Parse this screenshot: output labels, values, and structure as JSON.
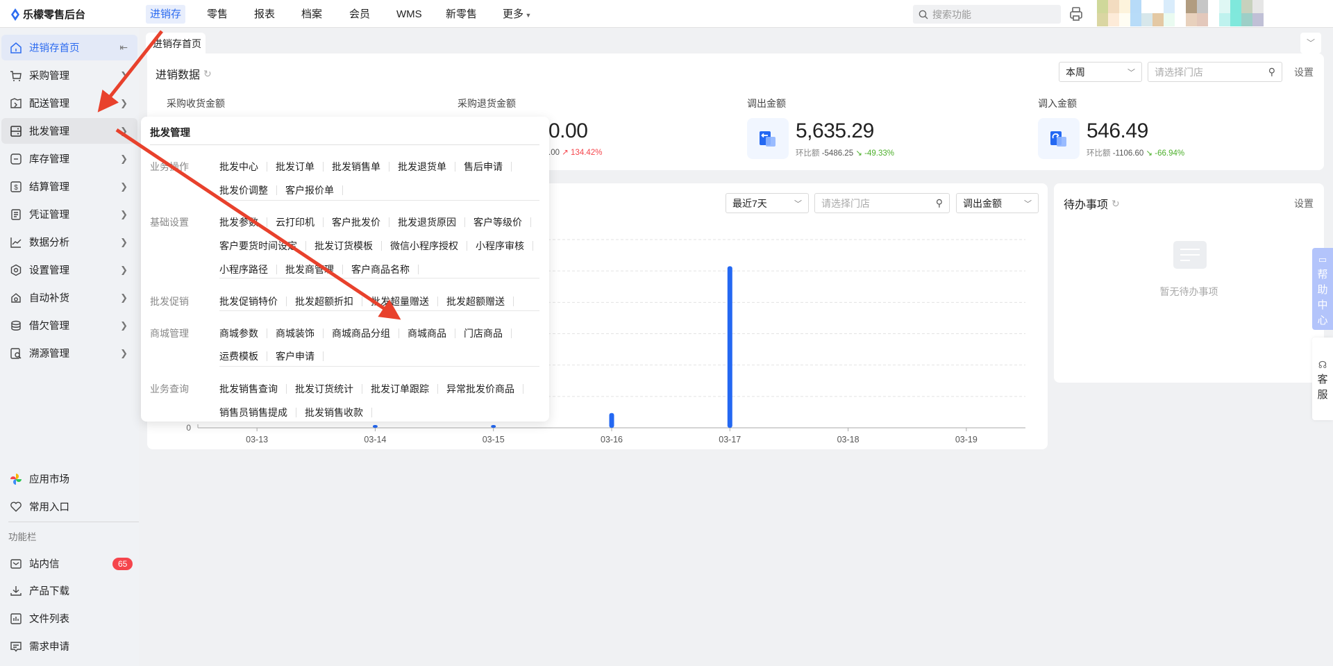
{
  "app": {
    "title": "乐檬零售后台"
  },
  "topnav": {
    "items": [
      "进销存",
      "零售",
      "报表",
      "档案",
      "会员",
      "WMS",
      "新零售",
      "更多"
    ],
    "active_index": 0,
    "search_placeholder": "搜索功能"
  },
  "sidebar": {
    "items": [
      {
        "label": "进销存首页",
        "icon": "home-icon"
      },
      {
        "label": "采购管理",
        "icon": "cart-icon"
      },
      {
        "label": "配送管理",
        "icon": "delivery-icon"
      },
      {
        "label": "批发管理",
        "icon": "wholesale-icon"
      },
      {
        "label": "库存管理",
        "icon": "inventory-icon"
      },
      {
        "label": "结算管理",
        "icon": "settlement-icon"
      },
      {
        "label": "凭证管理",
        "icon": "voucher-icon"
      },
      {
        "label": "数据分析",
        "icon": "chart-icon"
      },
      {
        "label": "设置管理",
        "icon": "settings-icon"
      },
      {
        "label": "自动补货",
        "icon": "replenish-icon"
      },
      {
        "label": "借欠管理",
        "icon": "debt-icon"
      },
      {
        "label": "溯源管理",
        "icon": "trace-icon"
      }
    ],
    "bottom": {
      "app_market": "应用市场",
      "favorites": "常用入口",
      "section_label": "功能栏",
      "messages": "站内信",
      "messages_count": "65",
      "downloads": "产品下载",
      "file_list": "文件列表",
      "requests": "需求申请"
    }
  },
  "tabs": {
    "items": [
      "进销存首页"
    ]
  },
  "summary": {
    "title": "进销数据",
    "period": "本周",
    "store_placeholder": "请选择门店",
    "settings": "设置",
    "metrics": [
      {
        "label": "采购收货金额"
      },
      {
        "label": "采购退货金额",
        "value": "0.00",
        "compare_value": ".00",
        "trend": "134.42%",
        "direction": "up"
      },
      {
        "label": "调出金额",
        "value": "5,635.29",
        "compare_label": "环比额",
        "compare_value": "-5486.25",
        "trend": "-49.33%",
        "direction": "down"
      },
      {
        "label": "调入金额",
        "value": "546.49",
        "compare_label": "环比额",
        "compare_value": "-1106.60",
        "trend": "-66.94%",
        "direction": "down"
      }
    ]
  },
  "trend_panel": {
    "range": "最近7天",
    "store_placeholder": "请选择门店",
    "metric": "调出金额"
  },
  "chart_data": {
    "type": "bar",
    "categories": [
      "03-13",
      "03-14",
      "03-15",
      "03-16",
      "03-17",
      "03-18",
      "03-19"
    ],
    "values": [
      0,
      8,
      8,
      470,
      5150,
      0,
      0
    ],
    "ylim": [
      0,
      6000
    ],
    "yticks": [
      0,
      1000,
      2000,
      3000,
      4000,
      5000,
      6000
    ],
    "visible_ytick_labels": [
      "0"
    ],
    "grid": true,
    "color": "#2468f2"
  },
  "todo": {
    "title": "待办事项",
    "settings": "设置",
    "empty_text": "暂无待办事项"
  },
  "float": {
    "help": "帮助中心",
    "service": "客服"
  },
  "popup": {
    "title": "批发管理",
    "sections": [
      {
        "label": "业务操作",
        "rows": [
          [
            "批发中心",
            "批发订单",
            "批发销售单",
            "批发退货单",
            "售后申请"
          ],
          [
            "批发价调整",
            "客户报价单"
          ]
        ]
      },
      {
        "label": "基础设置",
        "rows": [
          [
            "批发参数",
            "云打印机",
            "客户批发价",
            "批发退货原因",
            "客户等级价"
          ],
          [
            "客户要货时间设定",
            "批发订货模板",
            "微信小程序授权",
            "小程序审核"
          ],
          [
            "小程序路径",
            "批发商管理",
            "客户商品名称"
          ]
        ]
      },
      {
        "label": "批发促销",
        "rows": [
          [
            "批发促销特价",
            "批发超额折扣",
            "批发超量赠送",
            "批发超额赠送"
          ]
        ]
      },
      {
        "label": "商城管理",
        "rows": [
          [
            "商城参数",
            "商城装饰",
            "商城商品分组",
            "商城商品",
            "门店商品"
          ],
          [
            "运费模板",
            "客户申请"
          ]
        ]
      },
      {
        "label": "业务查询",
        "rows": [
          [
            "批发销售查询",
            "批发订货统计",
            "批发订单跟踪",
            "异常批发价商品"
          ],
          [
            "销售员销售提成",
            "批发销售收款"
          ]
        ]
      }
    ]
  },
  "watermark": "黄涛9986",
  "colors": {
    "accent": "#2d6cf0",
    "bar": "#2468f2",
    "badge": "#f5454c",
    "annotation": "#e8412c",
    "up": "#f5454c",
    "down": "#4caf2a"
  }
}
